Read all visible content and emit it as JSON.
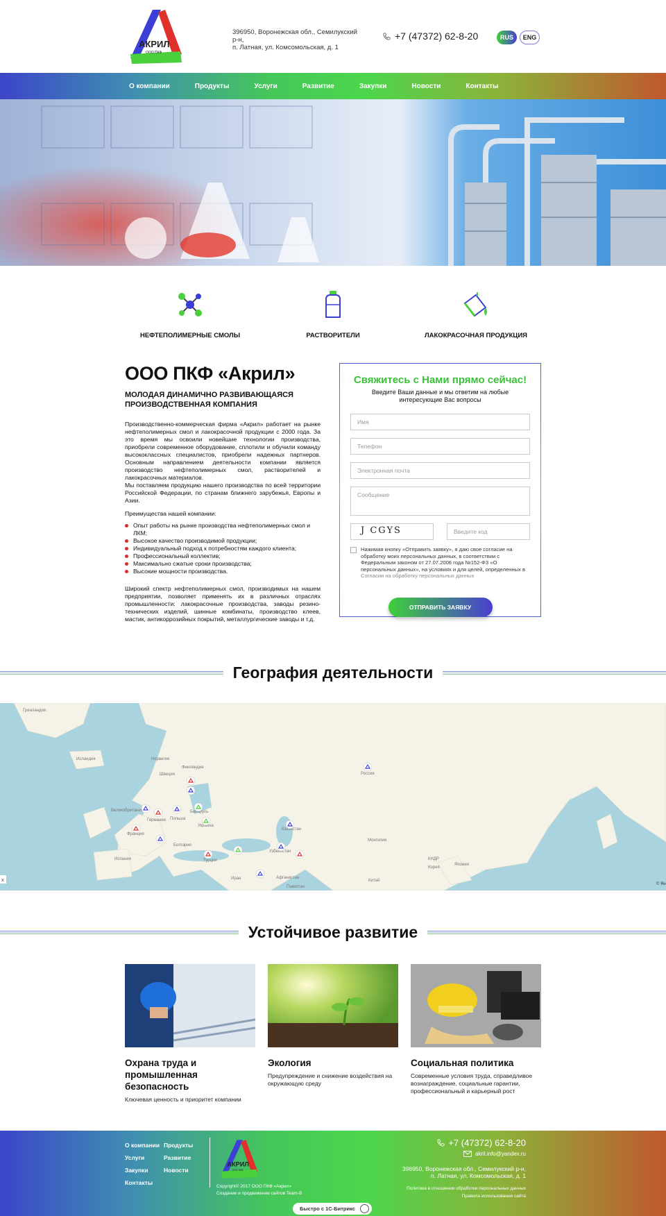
{
  "header": {
    "logo_text": "АКРИЛ",
    "logo_sub": "ООО ПКФ",
    "address_line1": "396950, Воронежская обл., Семилукский р-н,",
    "address_line2": "п. Латная, ул. Комсомольская, д. 1",
    "phone": "+7 (47372) 62-8-20",
    "lang_rus": "RUS",
    "lang_eng": "ENG"
  },
  "nav": [
    "О компании",
    "Продукты",
    "Услуги",
    "Развитие",
    "Закупки",
    "Новости",
    "Контакты"
  ],
  "products": [
    {
      "label": "НЕФТЕПОЛИМЕРНЫЕ СМОЛЫ",
      "icon": "molecule-icon"
    },
    {
      "label": "РАСТВОРИТЕЛИ",
      "icon": "canister-icon"
    },
    {
      "label": "ЛАКОКРАСОЧНАЯ ПРОДУКЦИЯ",
      "icon": "paint-bucket-icon"
    }
  ],
  "about": {
    "title": "ООО ПКФ «Акрил»",
    "subtitle": "МОЛОДАЯ ДИНАМИЧНО РАЗВИВАЮЩАЯСЯ ПРОИЗВОДСТВЕННАЯ КОМПАНИЯ",
    "p1": "Производственно-коммерческая фирма «Акрил» работает на рынке нефтеполимерных смол и лакокрасочной продукции с 2000 года. За это время мы освоили новейшие технологии производства, приобрели современное оборудование, сплотили и обучили команду высококлассных специалистов, приобрели надежных партнеров. Основным направлением деятельности компании является производство нефтеполимерных смол, растворителей и лакокрасочных материалов.",
    "p2": "Мы поставляем продукцию нашего производства по всей территории Российской Федерации, по странам ближнего зарубежья, Европы и Азии.",
    "adv_title": "Преимущества нашей компании:",
    "advantages": [
      "Опыт работы на рынке производства нефтеполимерных смол и ЛКМ;",
      "Высокое качество производимой продукции;",
      "Индивидуальный подход к потребностям каждого клиента;",
      "Профессиональный коллектив;",
      "Максимально сжатые сроки производства;",
      "Высокие мощности производства."
    ],
    "p3": "Широкий спектр нефтеполимерных смол, производимых на нашем предприятии, позволяет применять их в различных отраслях промышленности: лакокрасочные производства, заводы резино-технических изделий, шинные комбинаты, производство клеев, мастик, антикоррозийных покрытий, металлургические заводы и т.д."
  },
  "form": {
    "title": "Свяжитесь с Нами прямо сейчас!",
    "subtitle_line1": "Введите Ваши данные и мы ответим на любые",
    "subtitle_line2": "интересующие Вас вопросы",
    "name_placeholder": "Имя",
    "phone_placeholder": "Телефон",
    "email_placeholder": "Электронная почта",
    "message_placeholder": "Сообщение",
    "captcha_text": "J CGYS",
    "code_placeholder": "Введите код",
    "consent_text": "Нажимая кнопку «Отправить заявку», я даю свое согласие на обработку моих персональных данных, в соответствии с Федеральным законом от 27.07.2006 года №152-ФЗ «О персональных данных», на условиях и для целей, определенных в",
    "consent_link": "Согласии на обработку персональных данных",
    "submit_label": "ОТПРАВИТЬ ЗАЯВКУ"
  },
  "geo": {
    "title": "География деятельности",
    "labels": [
      "Гренландия",
      "Исландия",
      "Норвегия",
      "Финляндия",
      "Швеция",
      "Россия",
      "Великобритания",
      "Германия",
      "Польша",
      "Беларусь",
      "Украина",
      "Франция",
      "Казахстан",
      "Монголия",
      "Испания",
      "Болгария",
      "Турция",
      "Узбекистан",
      "Иран",
      "Афганистан",
      "Пакистан",
      "Китай",
      "КНДР",
      "Корея",
      "Япония"
    ],
    "attribution": "© Ян",
    "zoom_label": "x"
  },
  "sustain": {
    "title": "Устойчивое развитие",
    "cards": [
      {
        "title": "Охрана труда и промышленная безопасность",
        "text": "Ключевая ценность и приоритет компании"
      },
      {
        "title": "Экология",
        "text": "Предупреждение и снижение воздействия на окружающую среду"
      },
      {
        "title": "Социальная политика",
        "text": "Современные условия труда, справедливое вознаграждение, социальные гарантии, профессиональный и карьерный рост"
      }
    ]
  },
  "footer": {
    "links": [
      "О компании",
      "Продукты",
      "Услуги",
      "Развитие",
      "Закупки",
      "Новости",
      "Контакты"
    ],
    "copyright": "Copyright© 2017 ООО ПКФ «Акрил»",
    "made_by": "Создание и продвижение сайтов Team-B",
    "bitrix": "Быстро с 1С-Битрикс",
    "phone": "+7 (47372) 62-8-20",
    "email": "akril.info@yandex.ru",
    "address_line1": "396950, Воронежская обл., Семилукский р-н,",
    "address_line2": "п. Латная, ул. Комсомольская, д. 1",
    "policy1": "Политика в отношении обработки персональных данных",
    "policy2": "Правила использования сайта"
  }
}
